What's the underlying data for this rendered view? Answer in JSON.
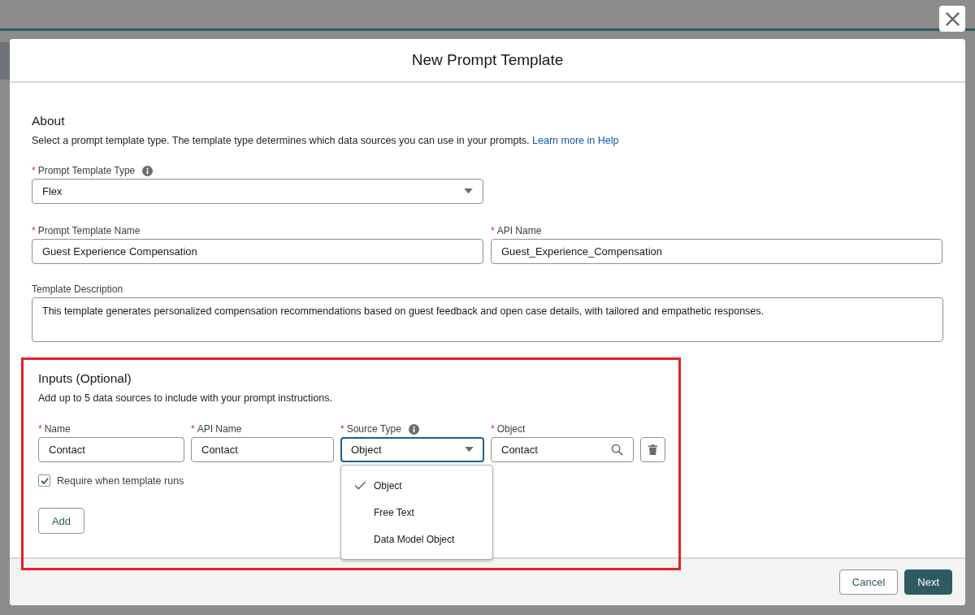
{
  "window": {
    "title": "New Prompt Template"
  },
  "about": {
    "heading": "About",
    "description": "Select a prompt template type. The template type determines which data sources you can use in your prompts.",
    "link": "Learn more in Help"
  },
  "template_type": {
    "required_mark": "*",
    "label": "Prompt Template Type",
    "info": true,
    "value": "Flex"
  },
  "template_name": {
    "required_mark": "*",
    "label": "Prompt Template Name",
    "value": "Guest Experience Compensation"
  },
  "api_name": {
    "required_mark": "*",
    "label": "API Name",
    "value": "Guest_Experience_Compensation"
  },
  "template_description": {
    "label": "Template Description",
    "value": "This template generates personalized compensation recommendations based on guest feedback and open case details, with tailored and empathetic responses."
  },
  "inputs": {
    "heading": "Inputs (Optional)",
    "description": "Add up to 5 data sources to include with your prompt instructions.",
    "fields": [
      {
        "kind": "text",
        "required_mark": "*",
        "label": "Name",
        "value": "Contact"
      },
      {
        "kind": "text",
        "required_mark": "*",
        "label": "API Name",
        "value": "Contact"
      },
      {
        "kind": "select",
        "required_mark": "*",
        "label": "Source Type",
        "value": "Object",
        "info": true,
        "expanded": true
      },
      {
        "kind": "lookup",
        "required_mark": "*",
        "label": "Object",
        "value": "Contact"
      }
    ],
    "source_options": [
      {
        "label": "Object",
        "selected": true
      },
      {
        "label": "Free Text",
        "selected": false
      },
      {
        "label": "Data Model Object",
        "selected": false
      }
    ],
    "require_checkbox": {
      "label": "Require when template runs",
      "checked": true
    },
    "add_button": "Add"
  },
  "footer": {
    "cancel": "Cancel",
    "next": "Next"
  }
}
